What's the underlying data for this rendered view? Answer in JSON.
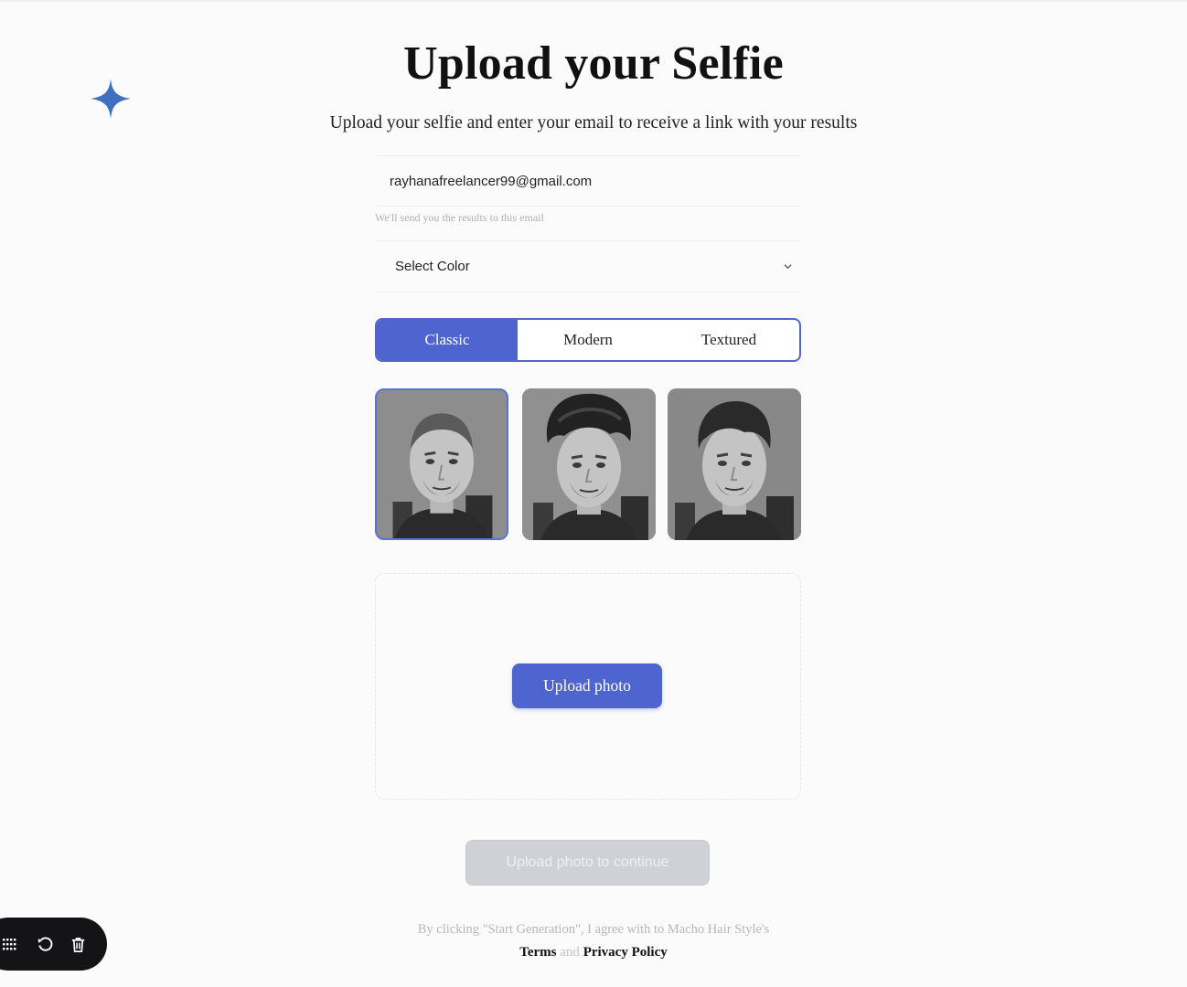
{
  "page": {
    "title": "Upload your Selfie",
    "subtitle": "Upload your selfie and enter your email to receive a link with your results"
  },
  "email": {
    "value": "rayhanafreelancer99@gmail.com",
    "hint": "We'll send you the results to this email"
  },
  "color_select": {
    "selected": "Select Color"
  },
  "style_tabs": [
    {
      "label": "Classic",
      "active": true
    },
    {
      "label": "Modern",
      "active": false
    },
    {
      "label": "Textured",
      "active": false
    }
  ],
  "style_thumbnails": [
    "classic-buzz-cut",
    "modern-quiff",
    "textured-pompadour"
  ],
  "upload": {
    "button_label": "Upload photo"
  },
  "continue": {
    "button_label": "Upload photo to continue",
    "disabled": true
  },
  "legal": {
    "agree_text": "By clicking \"Start Generation\", I agree with to Macho Hair Style's",
    "terms": "Terms",
    "and": "and",
    "privacy": "Privacy Policy"
  },
  "colors": {
    "accent": "#4e64cf",
    "sparkle": "#3e6fc0",
    "disabled_button": "#cfd1d6",
    "toolbar": "#141416"
  },
  "toolbar_icons": [
    "grid-icon",
    "undo-icon",
    "trash-icon"
  ]
}
